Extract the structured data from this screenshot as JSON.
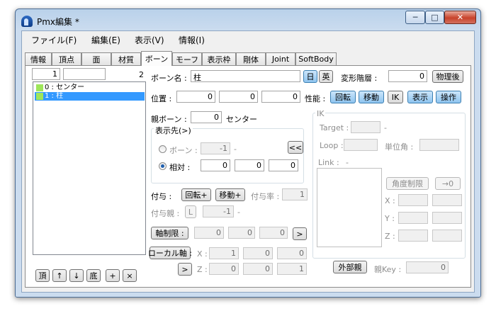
{
  "window": {
    "title": "Pmx編集 *",
    "min_label": "─",
    "max_label": "□",
    "close_label": "✕"
  },
  "menu": [
    "ファイル(F)",
    "編集(E)",
    "表示(V)",
    "情報(I)"
  ],
  "tabs": [
    "情報",
    "頂点",
    "面",
    "材質",
    "ボーン",
    "モーフ",
    "表示枠",
    "剛体",
    "Joint",
    "SoftBody"
  ],
  "active_tab": "ボーン",
  "left": {
    "index_value": "1",
    "search_value": "",
    "count": "2",
    "bones": [
      "0 : センター",
      "1 : 柱"
    ],
    "selected_index": 1,
    "bottom_buttons": [
      "頂",
      "↑",
      "↓",
      "底",
      "+",
      "×"
    ]
  },
  "bone": {
    "name_label": "ボーン名 :",
    "name_value": "柱",
    "lang_jp": "日",
    "lang_en": "英",
    "deform_label": "変形階層 :",
    "deform_value": "0",
    "physics_after": "物理後",
    "pos_label": "位置 :",
    "pos": [
      "0",
      "0",
      "0"
    ],
    "perf_label": "性能 :",
    "perf_buttons": [
      "回転",
      "移動",
      "IK",
      "表示",
      "操作"
    ],
    "parent_label": "親ボーン :",
    "parent_value": "0",
    "parent_name": "センター",
    "disp_group_label": "表示先(>)",
    "disp_bone_label": "ボーン :",
    "disp_bone_value": "-1",
    "disp_bone_dash": "-",
    "disp_rel_label": "相対 :",
    "disp_rel": [
      "0",
      "0",
      "0"
    ],
    "arrow_btn": "<<",
    "grant_label": "付与 :",
    "grant_rot": "回転+",
    "grant_move": "移動+",
    "grant_rate_label": "付与率 :",
    "grant_rate_value": "1",
    "grant_parent_label": "付与親 :",
    "grant_parent_l": "L",
    "grant_parent_value": "-1",
    "grant_parent_dash": "-",
    "axis_label": "軸制限 :",
    "axis": [
      "0",
      "0",
      "0"
    ],
    "axis_arrow": ">",
    "local_label": "ローカル軸 :",
    "local_x_label": "X :",
    "local_x": [
      "1",
      "0",
      "0"
    ],
    "local_z_label": "Z :",
    "local_z": [
      "0",
      "0",
      "1"
    ],
    "local_arrow": ">"
  },
  "ik": {
    "group_label": "IK",
    "target_label": "Target :",
    "target_value": "",
    "target_dash": "-",
    "loop_label": "Loop :",
    "loop_value": "",
    "unit_label": "単位角 :",
    "unit_value": "",
    "link_label": "Link :",
    "link_dash": "-",
    "angle_limit": "角度制限",
    "to_zero": "→0",
    "axes": [
      "X :",
      "Y :",
      "Z :"
    ]
  },
  "external": {
    "button": "外部親",
    "key_label": "親Key :",
    "key_value": "0"
  }
}
